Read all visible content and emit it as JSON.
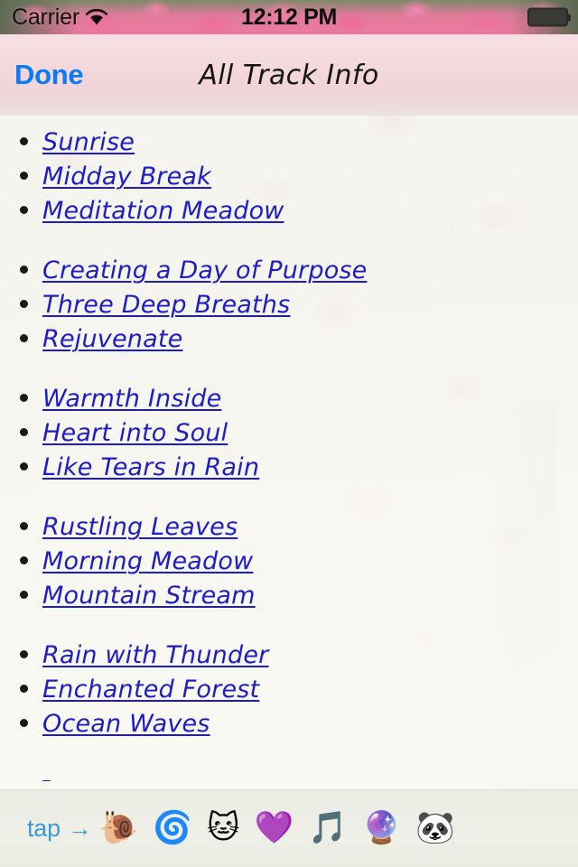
{
  "status_bar": {
    "carrier": "Carrier",
    "wifi_icon": "wifi-icon",
    "time": "12:12 PM",
    "battery_icon": "battery-full-icon"
  },
  "nav_bar": {
    "done_label": "Done",
    "title": "All Track Info",
    "done_color": "#0a7bf5",
    "background_color": "#f3d8dd"
  },
  "content": {
    "link_color": "#1c1ccb",
    "groups": [
      {
        "items": [
          {
            "label": "Sunrise"
          },
          {
            "label": "Midday Break"
          },
          {
            "label": "Meditation Meadow"
          }
        ]
      },
      {
        "items": [
          {
            "label": "Creating a Day of Purpose"
          },
          {
            "label": "Three Deep Breaths"
          },
          {
            "label": "Rejuvenate"
          }
        ]
      },
      {
        "items": [
          {
            "label": "Warmth Inside"
          },
          {
            "label": "Heart into Soul"
          },
          {
            "label": "Like Tears in Rain"
          }
        ]
      },
      {
        "items": [
          {
            "label": "Rustling Leaves"
          },
          {
            "label": "Morning Meadow"
          },
          {
            "label": "Mountain Stream"
          }
        ]
      },
      {
        "items": [
          {
            "label": "Rain with Thunder"
          },
          {
            "label": "Enchanted Forest"
          },
          {
            "label": "Ocean Waves"
          }
        ]
      }
    ]
  },
  "toolbar": {
    "tap_label": "tap",
    "tap_arrow": "→",
    "background_color": "#eceee6",
    "tap_label_color": "#3d9ad8",
    "buttons": [
      {
        "name": "snail-icon",
        "glyph": "🐌"
      },
      {
        "name": "cyclone-icon",
        "glyph": "🌀"
      },
      {
        "name": "cat-face-icon",
        "glyph": "🐱"
      },
      {
        "name": "purple-heart-icon",
        "glyph": "💜"
      },
      {
        "name": "musical-notes-icon",
        "glyph": "🎵"
      },
      {
        "name": "crystal-ball-icon",
        "glyph": "🔮"
      },
      {
        "name": "panda-face-icon",
        "glyph": "🐼"
      }
    ]
  }
}
